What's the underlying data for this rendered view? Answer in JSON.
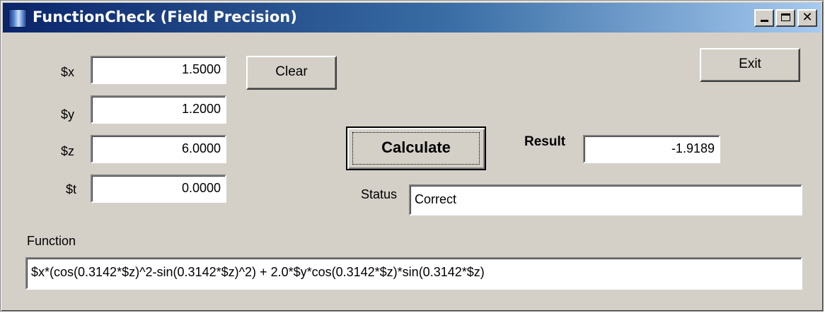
{
  "window": {
    "title": "FunctionCheck (Field Precision)"
  },
  "inputs": [
    {
      "label": "$x",
      "value": "1.5000"
    },
    {
      "label": "$y",
      "value": "1.2000"
    },
    {
      "label": "$z",
      "value": "6.0000"
    },
    {
      "label": "$t",
      "value": "0.0000"
    }
  ],
  "buttons": {
    "clear": "Clear",
    "exit": "Exit",
    "calculate": "Calculate"
  },
  "result": {
    "label": "Result",
    "value": "-1.9189"
  },
  "status": {
    "label": "Status",
    "value": "Correct"
  },
  "function": {
    "label": "Function",
    "value": "$x*(cos(0.3142*$z)^2-sin(0.3142*$z)^2) + 2.0*$y*cos(0.3142*$z)*sin(0.3142*$z)"
  },
  "icons": {
    "app": "app-icon",
    "minimize": "minimize-icon",
    "maximize": "maximize-icon",
    "close": "close-icon"
  }
}
